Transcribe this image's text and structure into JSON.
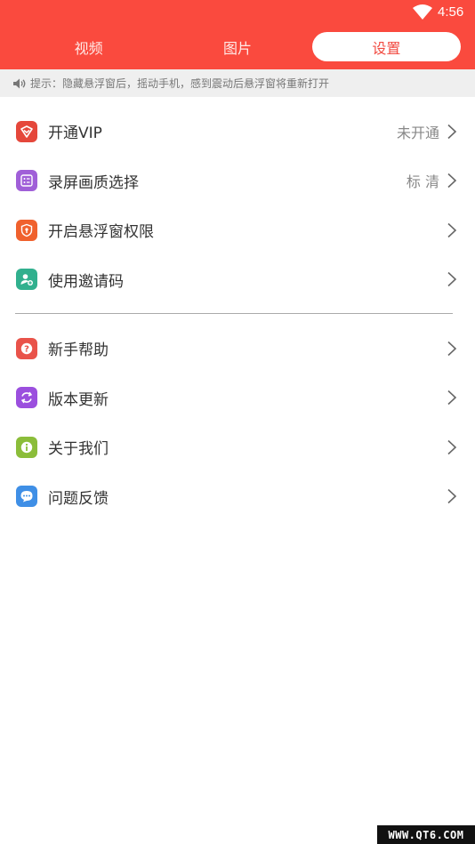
{
  "status_bar": {
    "time": "4:56"
  },
  "tabs": [
    {
      "label": "视频",
      "active": false
    },
    {
      "label": "图片",
      "active": false
    },
    {
      "label": "设置",
      "active": true
    }
  ],
  "tip": {
    "text": "提示：隐藏悬浮窗后，摇动手机，感到震动后悬浮窗将重新打开"
  },
  "settings_group_1": [
    {
      "label": "开通VIP",
      "value": "未开通",
      "icon": "vip-icon",
      "color": "#e5473b"
    },
    {
      "label": "录屏画质选择",
      "value": "标 清",
      "icon": "quality-icon",
      "color": "#a05fd8"
    },
    {
      "label": "开启悬浮窗权限",
      "value": "",
      "icon": "shield-icon",
      "color": "#f0612d"
    },
    {
      "label": "使用邀请码",
      "value": "",
      "icon": "add-user-icon",
      "color": "#31b08e"
    }
  ],
  "settings_group_2": [
    {
      "label": "新手帮助",
      "icon": "help-icon",
      "color": "#e9534a"
    },
    {
      "label": "版本更新",
      "icon": "refresh-icon",
      "color": "#9b4fde"
    },
    {
      "label": "关于我们",
      "icon": "info-icon",
      "color": "#8bbd3a"
    },
    {
      "label": "问题反馈",
      "icon": "feedback-icon",
      "color": "#3f8fe6"
    }
  ],
  "watermark": {
    "text": "WWW.QT6.COM"
  },
  "colors": {
    "header": "#fa4a3e",
    "active_tab_text": "#f14a40"
  }
}
